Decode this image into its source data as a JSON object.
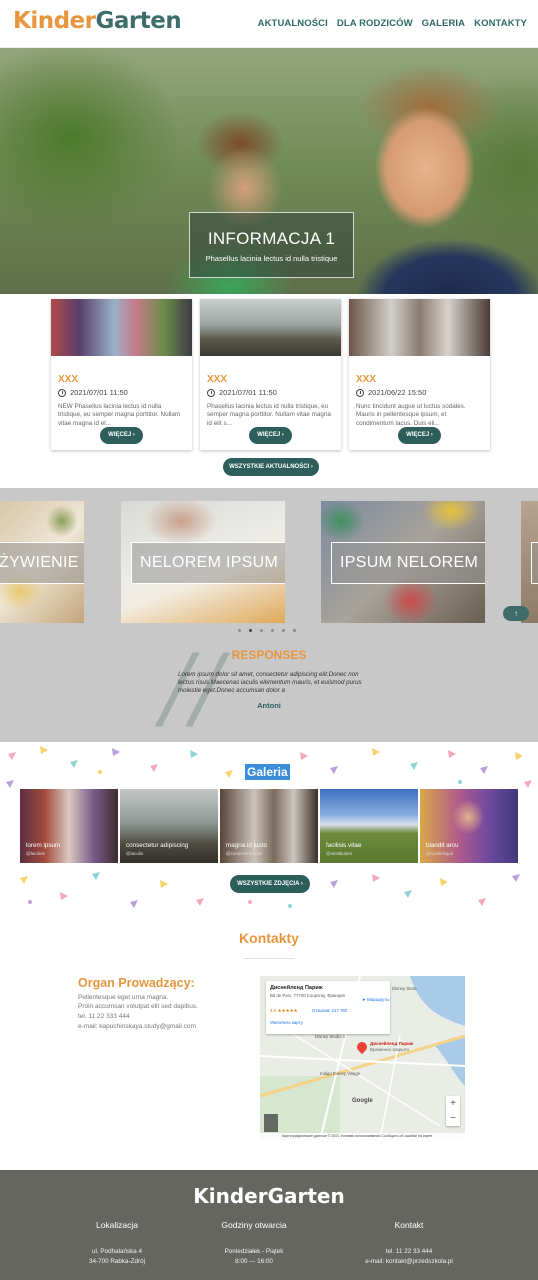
{
  "header": {
    "logo_part1": "Kinder",
    "logo_part2": "Garten",
    "nav": [
      "AKTUALNOŚCI",
      "DLA RODZICÓW",
      "GALERIA",
      "KONTAKTY"
    ]
  },
  "hero": {
    "title": "INFORMACJA 1",
    "subtitle": "Phasellus lacinia lectus id nulla tristique"
  },
  "news": {
    "cards": [
      {
        "title": "XXX",
        "date": "2021/07/01 11:50",
        "text": "NEW Phasellus lacinia lectus id nulla tristique, eu semper magna porttitor. Nullam vitae magna id el...",
        "button": "WIĘCEJ"
      },
      {
        "title": "XXX",
        "date": "2021/07/01 11:50",
        "text": "Phasellus lacinia lectus id nulla tristique, eu semper magna porttitor. Nullam vitae magna id elit s...",
        "button": "WIĘCEJ"
      },
      {
        "title": "XXX",
        "date": "2021/06/22 15:50",
        "text": "Nunc tincidunt augue ut luctus sodales. Mauris in pellentesque ipsum, et condimentum lacus. Duis eli...",
        "button": "WIĘCEJ"
      }
    ],
    "all_button": "WSZYSTKIE AKTUALNOŚCI"
  },
  "carousel": {
    "slides": [
      "ŻYWIENIE",
      "NELOREM IPSUM",
      "IPSUM NELOREM"
    ]
  },
  "responses": {
    "title": "RESPONSES",
    "text": "Lorem ipsum dolor sit amet, consectetur adipiscing elit.Donec non lectus risus.Maecenas iaculis elementum mauris, et euismod purus molestie eget.Donec accumsan dolor a",
    "author": "Antoni"
  },
  "gallery": {
    "title": "Galeria",
    "items": [
      {
        "caption": "lorem ipsum",
        "sub": "@facilisis"
      },
      {
        "caption": "consectetur adipiscing",
        "sub": "@iaculis"
      },
      {
        "caption": "magna id justo",
        "sub": "@consectetur|nisl"
      },
      {
        "caption": "facilisis vitae",
        "sub": "@vestibulum"
      },
      {
        "caption": "blandit arcu",
        "sub": "@scelerisque"
      }
    ],
    "button": "WSZYSTKIE ZDJĘCIA"
  },
  "contacts": {
    "title": "Kontakty",
    "org_title": "Organ Prowadzący:",
    "org_lines": [
      "Pellentesque eget urna magna.",
      "Proin accumsan volutpat elit sed dapibus.",
      "tel. 11 22 333 444",
      "e-mail: kapuchinskaya.study@gmail.com"
    ],
    "map": {
      "place": "Диснейленд Париж",
      "address": "Bd de Parc, 77700 Coupvray, Франция",
      "rating": "4,5 ★★★★★",
      "reviews": "Отзывов: 217 782",
      "route": "Маршруты",
      "larger_map": "Увеличить карту",
      "pin_label": "Диснейленд Париж",
      "pin_sub": "Временно закрыто",
      "zoom_in": "+",
      "zoom_out": "−",
      "google": "Google",
      "footer": "Картографические данные © 2021   Условия использования   Сообщить об ошибке на карте",
      "labels": [
        "Disney Studio 1",
        "Indigo Disney Village",
        "Disney Store"
      ]
    }
  },
  "footer": {
    "logo": "KinderGarten",
    "columns": [
      {
        "head": "Lokalizacja",
        "lines": [
          "ul. Podhalańska 4",
          "34-700 Rabka-Zdrój"
        ]
      },
      {
        "head": "Godziny otwarcia",
        "lines": [
          "Poniedziałek - Piątek",
          "8:00 — 16:00"
        ]
      },
      {
        "head": "Kontakt",
        "lines": [
          "tel. 11 22 33 444",
          "e-mail: kontakt@przedszkola.pl"
        ]
      }
    ]
  }
}
